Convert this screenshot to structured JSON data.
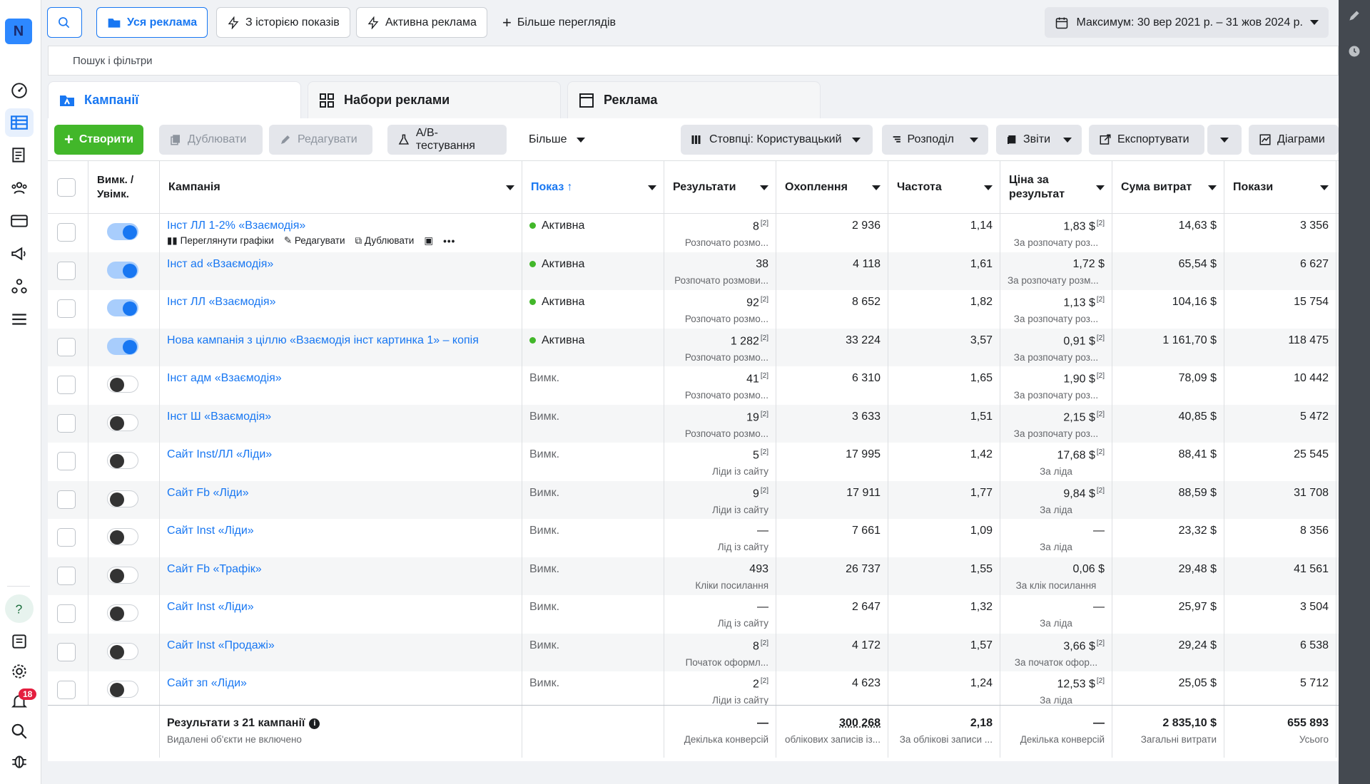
{
  "rail": {
    "logo": "N",
    "notifications_badge": "18"
  },
  "topbar": {
    "all_ads": "Уся реклама",
    "with_history": "З історією показів",
    "active_ads": "Активна реклама",
    "more_views": "Більше переглядів",
    "date_range": "Максимум: 30 вер 2021 р. – 31 жов 2024 р."
  },
  "search": {
    "placeholder": "Пошук і фільтри"
  },
  "tabs": [
    {
      "label": "Кампанії"
    },
    {
      "label": "Набори реклами"
    },
    {
      "label": "Реклама"
    }
  ],
  "toolbar": {
    "create": "Створити",
    "duplicate": "Дублювати",
    "edit": "Редагувати",
    "ab_test": "A/B-тестування",
    "more": "Більше",
    "columns": "Стовпці: Користувацький",
    "breakdown": "Розподіл",
    "reports": "Звіти",
    "export": "Експортувати",
    "charts": "Діаграми"
  },
  "columns": {
    "toggle": "Вимк. / Увімк.",
    "campaign": "Кампанія",
    "delivery": "Показ",
    "results": "Результати",
    "reach": "Охоплення",
    "frequency": "Частота",
    "cost_per_result": "Ціна за результат",
    "amount_spent": "Сума витрат",
    "impressions": "Покази"
  },
  "row_actions": {
    "view_charts": "Переглянути графіки",
    "edit": "Редагувати",
    "duplicate": "Дублювати"
  },
  "rows": [
    {
      "on": true,
      "name": "Інст ЛЛ 1-2% «Взаємодія»",
      "delivery": "Активна",
      "active": true,
      "results": "8",
      "results_sub": "Розпочато розмо...",
      "reach": "2 936",
      "freq": "1,14",
      "cpr": "1,83 $",
      "cpr_sub": "За розпочату роз...",
      "spent": "14,63 $",
      "impr": "3 356",
      "sup": true
    },
    {
      "on": true,
      "name": "Інст ad «Взаємодія»",
      "delivery": "Активна",
      "active": true,
      "results": "38",
      "results_sub": "Розпочато розмови...",
      "reach": "4 118",
      "freq": "1,61",
      "cpr": "1,72 $",
      "cpr_sub": "За розпочату розм...",
      "spent": "65,54 $",
      "impr": "6 627",
      "sup": false
    },
    {
      "on": true,
      "name": "Інст ЛЛ «Взаємодія»",
      "delivery": "Активна",
      "active": true,
      "results": "92",
      "results_sub": "Розпочато розмо...",
      "reach": "8 652",
      "freq": "1,82",
      "cpr": "1,13 $",
      "cpr_sub": "За розпочату роз...",
      "spent": "104,16 $",
      "impr": "15 754",
      "sup": true
    },
    {
      "on": true,
      "name": "Нова кампанія з ціллю «Взаємодія інст картинка 1» – копія",
      "delivery": "Активна",
      "active": true,
      "results": "1 282",
      "results_sub": "Розпочато розмо...",
      "reach": "33 224",
      "freq": "3,57",
      "cpr": "0,91 $",
      "cpr_sub": "За розпочату роз...",
      "spent": "1 161,70 $",
      "impr": "118 475",
      "sup": true
    },
    {
      "on": false,
      "name": "Інст адм «Взаємодія»",
      "delivery": "Вимк.",
      "active": false,
      "results": "41",
      "results_sub": "Розпочато розмо...",
      "reach": "6 310",
      "freq": "1,65",
      "cpr": "1,90 $",
      "cpr_sub": "За розпочату роз...",
      "spent": "78,09 $",
      "impr": "10 442",
      "sup": true
    },
    {
      "on": false,
      "name": "Інст Ш «Взаємодія»",
      "delivery": "Вимк.",
      "active": false,
      "results": "19",
      "results_sub": "Розпочато розмо...",
      "reach": "3 633",
      "freq": "1,51",
      "cpr": "2,15 $",
      "cpr_sub": "За розпочату роз...",
      "spent": "40,85 $",
      "impr": "5 472",
      "sup": true
    },
    {
      "on": false,
      "name": "Сайт Inst/ЛЛ «Ліди»",
      "delivery": "Вимк.",
      "active": false,
      "results": "5",
      "results_sub": "Ліди із сайту",
      "reach": "17 995",
      "freq": "1,42",
      "cpr": "17,68 $",
      "cpr_sub": "За ліда",
      "spent": "88,41 $",
      "impr": "25 545",
      "sup": true
    },
    {
      "on": false,
      "name": "Сайт Fb «Ліди»",
      "delivery": "Вимк.",
      "active": false,
      "results": "9",
      "results_sub": "Ліди із сайту",
      "reach": "17 911",
      "freq": "1,77",
      "cpr": "9,84 $",
      "cpr_sub": "За ліда",
      "spent": "88,59 $",
      "impr": "31 708",
      "sup": true
    },
    {
      "on": false,
      "name": "Сайт Inst «Ліди»",
      "delivery": "Вимк.",
      "active": false,
      "results": "—",
      "results_sub": "Лід із сайту",
      "reach": "7 661",
      "freq": "1,09",
      "cpr": "—",
      "cpr_sub": "За ліда",
      "spent": "23,32 $",
      "impr": "8 356",
      "sup": false
    },
    {
      "on": false,
      "name": "Сайт Fb «Трафік»",
      "delivery": "Вимк.",
      "active": false,
      "results": "493",
      "results_sub": "Кліки посилання",
      "reach": "26 737",
      "freq": "1,55",
      "cpr": "0,06 $",
      "cpr_sub": "За клік посилання",
      "spent": "29,48 $",
      "impr": "41 561",
      "sup": false
    },
    {
      "on": false,
      "name": "Сайт Inst «Ліди»",
      "delivery": "Вимк.",
      "active": false,
      "results": "—",
      "results_sub": "Лід із сайту",
      "reach": "2 647",
      "freq": "1,32",
      "cpr": "—",
      "cpr_sub": "За ліда",
      "spent": "25,97 $",
      "impr": "3 504",
      "sup": false
    },
    {
      "on": false,
      "name": "Сайт Inst «Продажі»",
      "delivery": "Вимк.",
      "active": false,
      "results": "8",
      "results_sub": "Початок оформл...",
      "reach": "4 172",
      "freq": "1,57",
      "cpr": "3,66 $",
      "cpr_sub": "За початок офор...",
      "spent": "29,24 $",
      "impr": "6 538",
      "sup": true
    },
    {
      "on": false,
      "name": "Сайт зп «Ліди»",
      "delivery": "Вимк.",
      "active": false,
      "results": "2",
      "results_sub": "Ліди із сайту",
      "reach": "4 623",
      "freq": "1,24",
      "cpr": "12,53 $",
      "cpr_sub": "За ліда",
      "spent": "25,05 $",
      "impr": "5 712",
      "sup": true
    }
  ],
  "totals": {
    "title": "Результати з 21 кампанії",
    "note": "Видалені об'єкти не включено",
    "results": "—",
    "results_sub": "Декілька конверсій",
    "reach": "300 268",
    "reach_sub": "облікових записів із...",
    "freq": "2,18",
    "freq_sub": "За облікові записи ...",
    "cpr": "—",
    "cpr_sub": "Декілька конверсій",
    "spent": "2 835,10 $",
    "spent_sub": "Загальні витрати",
    "impr": "655 893",
    "impr_sub": "Усього"
  }
}
